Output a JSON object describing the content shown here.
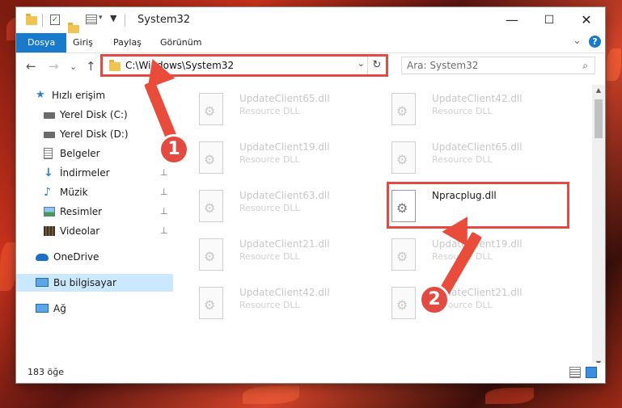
{
  "window": {
    "title": "System32",
    "minimize": "—",
    "maximize": "☐",
    "close": "✕"
  },
  "ribbon": {
    "tabs": [
      "Dosya",
      "Giriş",
      "Paylaş",
      "Görünüm"
    ],
    "collapse": "⌄",
    "help": "?"
  },
  "nav": {
    "back": "←",
    "forward": "→",
    "recent": "⌄",
    "up": "↑",
    "address": "C:\\Windows\\System32",
    "address_dropdown": "⌄",
    "refresh": "↻",
    "search_placeholder": "Ara: System32",
    "search_icon": "⌕"
  },
  "sidebar": {
    "items": [
      {
        "label": "Hızlı erişim",
        "icon": "star-icon",
        "pinned": false
      },
      {
        "label": "Yerel Disk (C:)",
        "icon": "drive-icon",
        "pinned": false
      },
      {
        "label": "Yerel Disk (D:)",
        "icon": "drive-icon",
        "pinned": false
      },
      {
        "label": "Belgeler",
        "icon": "documents-icon",
        "pinned": false
      },
      {
        "label": "İndirmeler",
        "icon": "download-icon",
        "pinned": true
      },
      {
        "label": "Müzik",
        "icon": "music-icon",
        "pinned": true
      },
      {
        "label": "Resimler",
        "icon": "pictures-icon",
        "pinned": true
      },
      {
        "label": "Videolar",
        "icon": "videos-icon",
        "pinned": true
      },
      {
        "label": "OneDrive",
        "icon": "cloud-icon",
        "pinned": false
      },
      {
        "label": "Bu bilgisayar",
        "icon": "computer-icon",
        "pinned": false,
        "selected": true
      },
      {
        "label": "Ağ",
        "icon": "network-icon",
        "pinned": false
      }
    ],
    "pin_glyph": "📌"
  },
  "files": [
    {
      "name": "UpdateClient65.dll",
      "desc": "Resource DLL"
    },
    {
      "name": "UpdateClient42.dll",
      "desc": "Resource DLL"
    },
    {
      "name": "UpdateClient19.dll",
      "desc": "Resource DLL"
    },
    {
      "name": "UpdateClient65.dll",
      "desc": "Resource DLL"
    },
    {
      "name": "UpdateClient63.dll",
      "desc": "Resource DLL"
    },
    {
      "name": "Npracplug.dll",
      "desc": "",
      "highlighted": true
    },
    {
      "name": "UpdateClient21.dll",
      "desc": "Resource DLL"
    },
    {
      "name": "UpdateClient19.dll",
      "desc": "Resource DLL"
    },
    {
      "name": "UpdateClient42.dll",
      "desc": "Resource DLL"
    },
    {
      "name": "UpdateClient21.dll",
      "desc": "Resource DLL"
    }
  ],
  "scrollbar": {
    "up": "▲",
    "down": "▼"
  },
  "status": {
    "count": "183 öğe"
  },
  "annotations": {
    "badge1": "1",
    "badge2": "2",
    "color": "#e34b42"
  }
}
